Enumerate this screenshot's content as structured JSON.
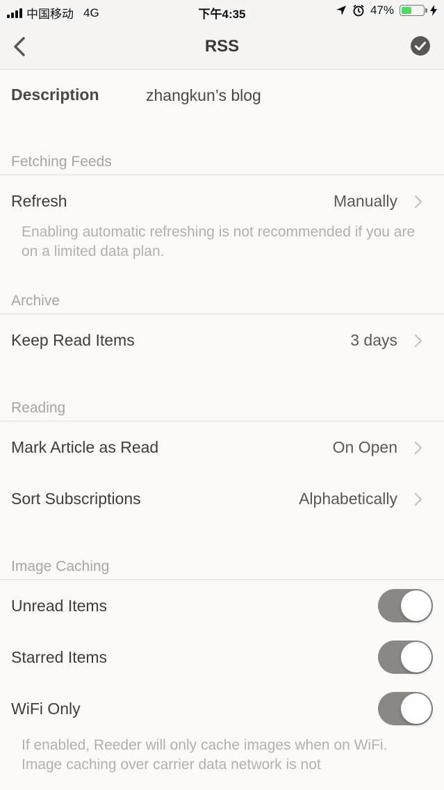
{
  "status_bar": {
    "carrier": "中国移动",
    "network": "4G",
    "time": "下午4:35",
    "battery_percent": "47%",
    "battery_level": 0.47
  },
  "nav": {
    "title": "RSS"
  },
  "description": {
    "label": "Description",
    "value": "zhangkun’s blog"
  },
  "sections": {
    "fetching": {
      "header": "Fetching Feeds",
      "refresh_label": "Refresh",
      "refresh_value": "Manually",
      "footnote": "Enabling automatic refreshing is not recommended if you are on a limited data plan."
    },
    "archive": {
      "header": "Archive",
      "keep_label": "Keep Read Items",
      "keep_value": "3 days"
    },
    "reading": {
      "header": "Reading",
      "mark_label": "Mark Article as Read",
      "mark_value": "On Open",
      "sort_label": "Sort Subscriptions",
      "sort_value": "Alphabetically"
    },
    "image_caching": {
      "header": "Image Caching",
      "unread_label": "Unread Items",
      "unread_on": true,
      "starred_label": "Starred Items",
      "starred_on": true,
      "wifi_label": "WiFi Only",
      "wifi_on": true,
      "footnote": "If enabled, Reeder will only cache images when on WiFi. Image caching over carrier data network is not"
    }
  },
  "colors": {
    "background": "#fbfaf8",
    "toggle_on": "#8a8784",
    "battery_fill": "#4cd964"
  }
}
